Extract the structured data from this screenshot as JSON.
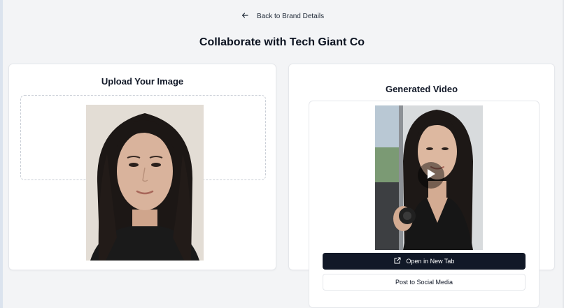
{
  "header": {
    "back_label": "Back to Brand Details",
    "title": "Collaborate with Tech Giant Co"
  },
  "upload_card": {
    "title": "Upload Your Image"
  },
  "video_card": {
    "title": "Generated Video",
    "open_tab_label": "Open in New Tab",
    "post_social_label": "Post to Social Media"
  },
  "icons": {
    "back": "arrow-left-icon",
    "play": "play-icon",
    "external_link": "external-link-icon"
  },
  "colors": {
    "page_bg": "#f3f4f6",
    "primary_button": "#111827",
    "card_bg": "#ffffff"
  }
}
